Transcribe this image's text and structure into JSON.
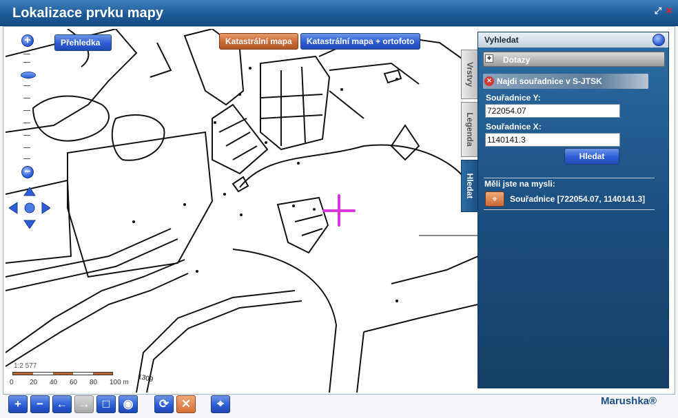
{
  "window": {
    "title": "Lokalizace prvku mapy",
    "restore_icon": "restore-icon",
    "close_icon": "close-icon"
  },
  "map": {
    "overview_button": "Přehledka",
    "layer_buttons": [
      "Katastrální mapa",
      "Katastrální mapa + ortofoto"
    ],
    "scale_ratio": "1:2 577",
    "scale_ticks": [
      "0",
      "20",
      "40",
      "60",
      "80",
      "100 m"
    ],
    "parcel_label": "1309",
    "zoom_in": "+",
    "zoom_out": "−"
  },
  "panel": {
    "title": "Vyhledat",
    "tabs": [
      "Vrstvy",
      "Legenda",
      "Hledat"
    ],
    "queries_label": "Dotazy",
    "queries_toggle": "+",
    "find_title": "Najdi souřadnice v S-JTSK",
    "coord_y_label": "Souřadnice Y:",
    "coord_y_value": "722054.07",
    "coord_x_label": "Souřadnice X:",
    "coord_x_value": "1140141.3",
    "search_button": "Hledat",
    "did_you_mean": "Měli jste na mysli:",
    "result": "Souřadnice [722054.07, 1140141.3]"
  },
  "toolbar": {
    "buttons": [
      "zoom-in",
      "zoom-out",
      "back",
      "forward",
      "zoom-box",
      "info",
      "refresh",
      "clear",
      "locate"
    ],
    "glyphs": [
      "+",
      "−",
      "←",
      "→",
      "□",
      "◉",
      "⟳",
      "✕",
      "⌖"
    ]
  },
  "brand": "Marushka®"
}
